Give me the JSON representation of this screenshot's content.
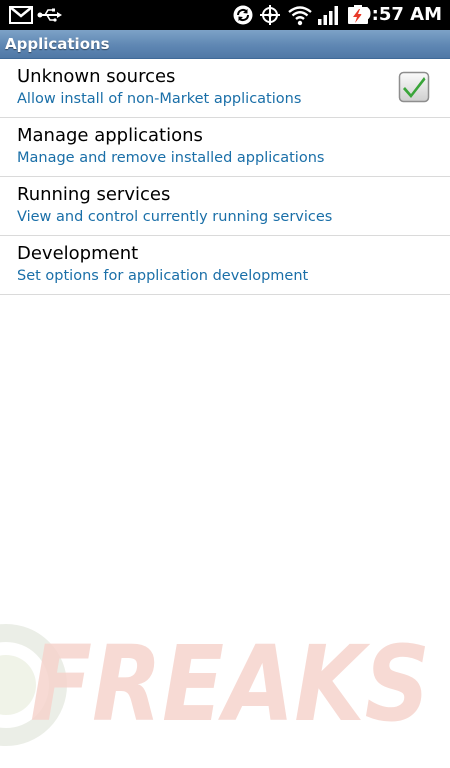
{
  "status_bar": {
    "time": "9:57 AM",
    "icons": [
      "gmail-icon",
      "usb-icon",
      "sync-icon",
      "gps-icon",
      "wifi-icon",
      "signal-icon",
      "battery-charging-icon"
    ]
  },
  "header": {
    "title": "Applications"
  },
  "settings": {
    "items": [
      {
        "title": "Unknown sources",
        "summary": "Allow install of non-Market applications",
        "checked": true
      },
      {
        "title": "Manage applications",
        "summary": "Manage and remove installed applications"
      },
      {
        "title": "Running services",
        "summary": "View and control currently running services"
      },
      {
        "title": "Development",
        "summary": "Set options for application development"
      }
    ]
  },
  "watermark": {
    "text": "FREAKS"
  },
  "colors": {
    "status_bar_bg": "#000000",
    "title_bar": "#5f87b3",
    "summary_text": "#1a6fa8",
    "checkbox_check": "#3aa53a",
    "watermark": "#f4c9c2"
  }
}
